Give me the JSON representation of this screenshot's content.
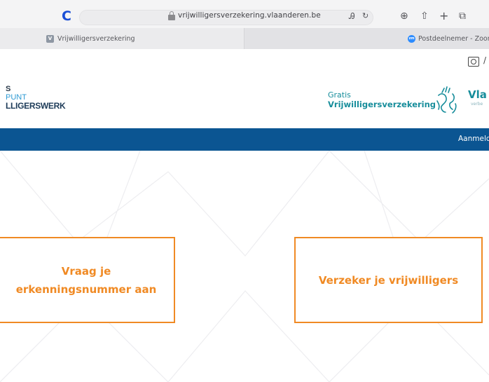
{
  "browser": {
    "url": "vrijwilligersverzekering.vlaanderen.be",
    "tabs": [
      {
        "label": "Vrijwilligersverzekering",
        "icon": "vlaanderen-favicon",
        "active": true
      },
      {
        "label": "Postdeelnemer - Zoom",
        "icon": "zoom-favicon",
        "active": false
      }
    ],
    "icons": [
      "reload-icon",
      "lock-icon",
      "translate-icon",
      "download-icon",
      "share-icon",
      "new-tab-icon",
      "tab-overview-icon",
      "reader-icon"
    ]
  },
  "header": {
    "logo_left": {
      "line1": "S",
      "line2": "PUNT",
      "line3": "LLIGERSWERK"
    },
    "product": {
      "line1": "Gratis",
      "line2": "Vrijwilligersverzekering"
    },
    "gov_logo": {
      "text": "Vla",
      "subtext": "verbe"
    }
  },
  "nav": {
    "login": "Aanmeld"
  },
  "cards": [
    {
      "line1": "Vraag je",
      "line2": "erkenningsnummer aan"
    },
    {
      "label": "Verzeker je vrijwilligers"
    }
  ],
  "colors": {
    "accent": "#f08a24",
    "nav": "#0b5592",
    "brand": "#178d9b"
  }
}
